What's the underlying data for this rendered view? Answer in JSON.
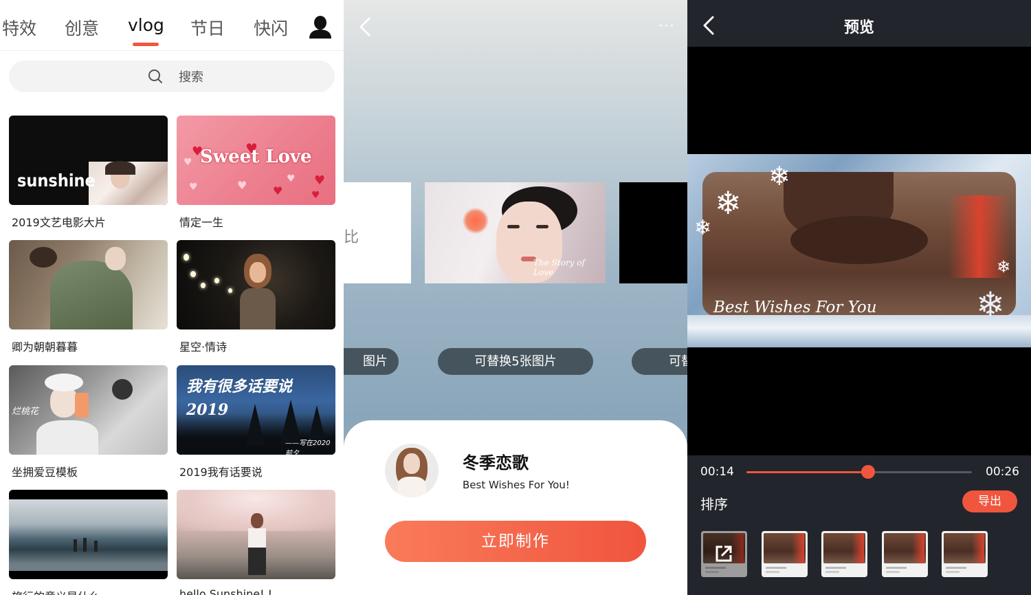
{
  "panel1": {
    "tabs": [
      "特效",
      "创意",
      "vlog",
      "节日",
      "快闪"
    ],
    "active_tab": "vlog",
    "search_placeholder": "搜索",
    "templates": [
      {
        "title": "2019文艺电影大片",
        "overlay_text": "sunshine"
      },
      {
        "title": "情定一生",
        "overlay_text": "Sweet Love"
      },
      {
        "title": "卿为朝朝暮暮",
        "overlay_text": ""
      },
      {
        "title": "星空·情诗",
        "overlay_text": ""
      },
      {
        "title": "坐拥爱豆模板",
        "overlay_text": "烂桃花"
      },
      {
        "title": "2019我有话要说",
        "overlay_text": "我有很多话要说 2019",
        "overlay_sub": "——写在2020前夕"
      },
      {
        "title": "旅行的意义是什么",
        "overlay_text": ""
      },
      {
        "title": "hello Sunshine! !",
        "overlay_text": ""
      }
    ]
  },
  "panel2": {
    "more_icon": "···",
    "left_card_text": "比",
    "center_card_caption": "The Story of Love",
    "pill_left": "图片",
    "pill_center": "可替换5张图片",
    "pill_right": "可替",
    "sheet_title": "冬季恋歌",
    "sheet_subtitle": "Best Wishes For You!",
    "make_button": "立即制作"
  },
  "panel3": {
    "title": "预览",
    "preview_caption": "Best Wishes For You",
    "time_current": "00:14",
    "time_total": "00:26",
    "progress": 0.54,
    "sort_label": "排序",
    "export_label": "导出",
    "frame_count": 5
  },
  "colors": {
    "accent": "#f0553e",
    "dark_bg": "#22252b",
    "pill_bg": "#46555d"
  }
}
